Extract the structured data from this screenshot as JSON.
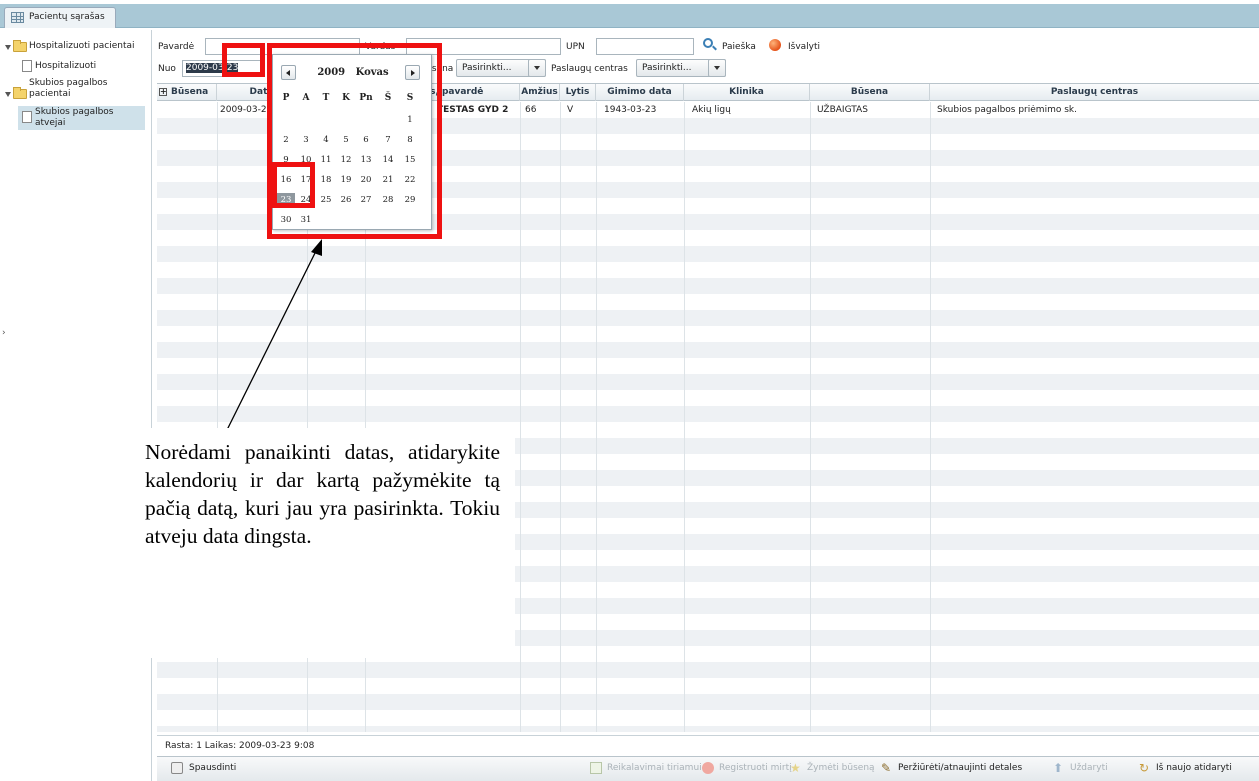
{
  "window": {
    "tab_label": "Pacientų sąrašas"
  },
  "tree": {
    "items": [
      {
        "label": "Hospitalizuoti pacientai"
      },
      {
        "label": "Hospitalizuoti"
      },
      {
        "label": "Skubios pagalbos pacientai"
      },
      {
        "label": "Skubios pagalbos atvejai"
      }
    ]
  },
  "filters": {
    "surname_label": "Pavardė",
    "name_label": "Vardas",
    "upn_label": "UPN",
    "from_label": "Nuo",
    "from_value": "2009-03-23",
    "status_label": "Būsena",
    "status_value": "Pasirinkti...",
    "service_center_label": "Paslaugų centras",
    "service_center_value": "Pasirinkti...",
    "search_label": "Paieška",
    "clear_label": "Išvalyti"
  },
  "grid": {
    "columns": [
      "Būsena",
      "Data",
      "Vardas, pavardė",
      "Amžius",
      "Lytis",
      "Gimimo data",
      "Klinika",
      "Būsena",
      "Paslaugų centras"
    ],
    "rows": [
      {
        "date": "2009-03-23",
        "name": "TESTAS GYD 2",
        "age": "66",
        "sex": "V",
        "birth": "1943-03-23",
        "clinic": "Akių ligų",
        "status": "UŽBAIGTAS",
        "center": "Skubios pagalbos priėmimo sk."
      }
    ]
  },
  "calendar": {
    "year": "2009",
    "month": "Kovas",
    "weekdays": [
      "P",
      "A",
      "T",
      "K",
      "Pn",
      "Š",
      "S"
    ],
    "weeks": [
      [
        "",
        "",
        "",
        "",
        "",
        "",
        "1"
      ],
      [
        "2",
        "3",
        "4",
        "5",
        "6",
        "7",
        "8"
      ],
      [
        "9",
        "10",
        "11",
        "12",
        "13",
        "14",
        "15"
      ],
      [
        "16",
        "17",
        "18",
        "19",
        "20",
        "21",
        "22"
      ],
      [
        "23",
        "24",
        "25",
        "26",
        "27",
        "28",
        "29"
      ],
      [
        "30",
        "31",
        "",
        "",
        "",
        "",
        ""
      ]
    ],
    "selected_day": "23"
  },
  "status_bar": {
    "text": "Rasta: 1  Laikas: 2009-03-23 9:08"
  },
  "footer": {
    "print_label": "Spausdinti",
    "disabled_actions": [
      "Reikalavimai tiriamui",
      "Registruoti mirtį",
      "Žymėti būseną"
    ],
    "review_label": "Peržiūrėti/atnaujinti detales",
    "close_label": "Uždaryti",
    "reopen_label": "Iš naujo atidaryti"
  },
  "annotation": {
    "text": "Norėdami panaikinti datas, atidarykite kalendorių ir dar kartą pažymėkite tą pačią datą, kuri jau yra pasirinkta. Tokiu atveju data dingsta."
  },
  "colors": {
    "annotation_red": "#ee1111",
    "tabbar": "#a9c8d6",
    "selected_day_bg": "#8e979e"
  }
}
